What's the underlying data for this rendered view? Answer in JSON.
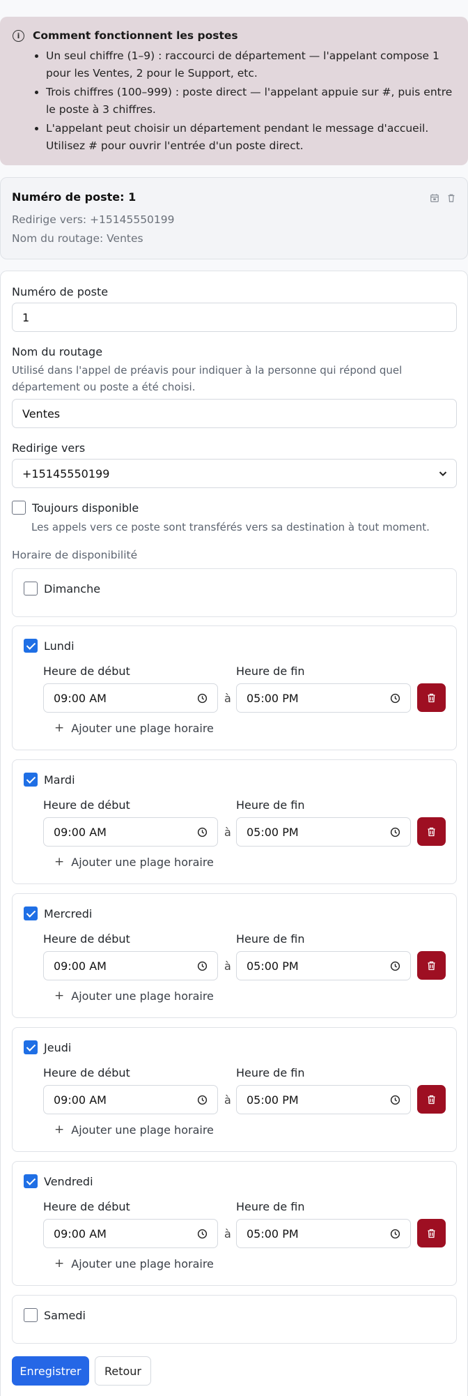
{
  "info": {
    "title": "Comment fonctionnent les postes",
    "bullets": [
      "Un seul chiffre (1–9) : raccourci de département — l'appelant compose 1 pour les Ventes, 2 pour le Support, etc.",
      "Trois chiffres (100–999) : poste direct — l'appelant appuie sur #, puis entre le poste à 3 chiffres.",
      "L'appelant peut choisir un département pendant le message d'accueil. Utilisez # pour ouvrir l'entrée d'un poste direct."
    ]
  },
  "extension_card": {
    "title": "Numéro de poste: 1",
    "redirect": "Redirige vers: +15145550199",
    "routing_name": "Nom du routage: Ventes"
  },
  "form": {
    "extension_label": "Numéro de poste",
    "extension_value": "1",
    "routing_label": "Nom du routage",
    "routing_help": "Utilisé dans l'appel de préavis pour indiquer à la personne qui répond quel département ou poste a été choisi.",
    "routing_value": "Ventes",
    "redirect_label": "Redirige vers",
    "redirect_value": "+15145550199",
    "always_label": "Toujours disponible",
    "always_help": "Les appels vers ce poste sont transférés vers sa destination à tout moment.",
    "always_checked": false,
    "schedule_label": "Horaire de disponibilité",
    "start_label": "Heure de début",
    "end_label": "Heure de fin",
    "separator": "à",
    "add_slot_label": "Ajouter une plage horaire",
    "days": [
      {
        "name": "Dimanche",
        "checked": false
      },
      {
        "name": "Lundi",
        "checked": true,
        "start": "09:00 AM",
        "end": "05:00 PM"
      },
      {
        "name": "Mardi",
        "checked": true,
        "start": "09:00 AM",
        "end": "05:00 PM"
      },
      {
        "name": "Mercredi",
        "checked": true,
        "start": "09:00 AM",
        "end": "05:00 PM"
      },
      {
        "name": "Jeudi",
        "checked": true,
        "start": "09:00 AM",
        "end": "05:00 PM"
      },
      {
        "name": "Vendredi",
        "checked": true,
        "start": "09:00 AM",
        "end": "05:00 PM"
      },
      {
        "name": "Samedi",
        "checked": false
      }
    ],
    "save_label": "Enregistrer",
    "back_label": "Retour"
  },
  "colors": {
    "accent": "#2567e6",
    "danger": "#9e0f22",
    "info_bg": "#e2d7dc"
  },
  "icons": {
    "info": "info-circle-icon",
    "calendar": "calendar-icon",
    "trash": "trash-icon",
    "clock": "clock-icon",
    "chevron": "chevron-down-icon",
    "plus": "plus-icon"
  }
}
